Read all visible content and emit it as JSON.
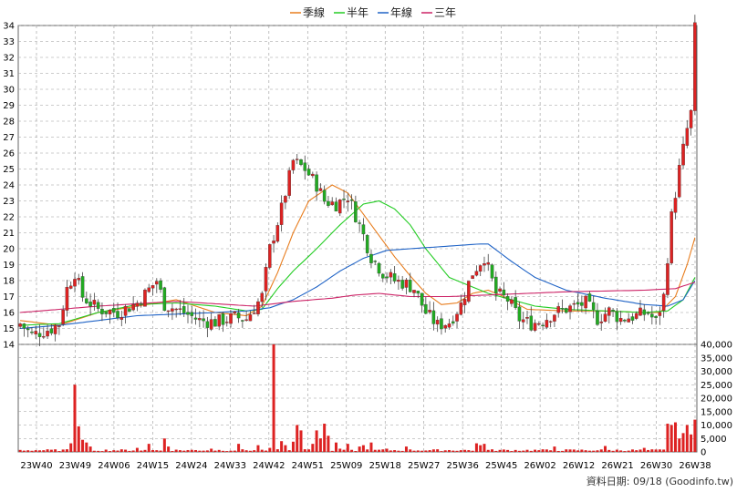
{
  "chart_data": {
    "type": "candlestick",
    "legend": {
      "placement": "top-center",
      "items": [
        {
          "name": "季線",
          "color": "#e87d1e"
        },
        {
          "name": "半年",
          "color": "#22cc22"
        },
        {
          "name": "年線",
          "color": "#1f63c6"
        },
        {
          "name": "三年",
          "color": "#cc2266"
        }
      ]
    },
    "price_axis": {
      "min": 14,
      "max": 34,
      "ticks": [
        14,
        15,
        16,
        17,
        18,
        19,
        20,
        21,
        22,
        23,
        24,
        25,
        26,
        27,
        28,
        29,
        30,
        31,
        32,
        33,
        34
      ],
      "side": "left"
    },
    "volume_axis": {
      "min": 0,
      "max": 40000,
      "ticks": [
        0,
        5000,
        10000,
        15000,
        20000,
        25000,
        30000,
        35000,
        40000
      ],
      "tick_labels": [
        "0",
        "5,000",
        "10,000",
        "15,000",
        "20,000",
        "25,000",
        "30,000",
        "35,000",
        "40,000"
      ],
      "side": "right"
    },
    "x_labels": [
      "23W40",
      "23W49",
      "24W06",
      "24W15",
      "24W24",
      "24W33",
      "24W42",
      "24W51",
      "25W09",
      "25W18",
      "25W27",
      "25W36",
      "25W45",
      "26W02",
      "26W12",
      "26W21",
      "26W30",
      "26W38"
    ],
    "colors": {
      "up": "#dd2222",
      "down": "#22aa22",
      "wick": "#444444",
      "volume": "#dd2222",
      "grid": "#999999"
    },
    "grid": true,
    "footer": "資料日期: 09/18  (Goodinfo.tw)",
    "anchors": {
      "close": [
        [
          0,
          15.3
        ],
        [
          3,
          14.6
        ],
        [
          8,
          15
        ],
        [
          10,
          15.3
        ],
        [
          12,
          17.5
        ],
        [
          14,
          18.5
        ],
        [
          16,
          17
        ],
        [
          20,
          16.2
        ],
        [
          25,
          16
        ],
        [
          30,
          16.6
        ],
        [
          35,
          18
        ],
        [
          37,
          16.5
        ],
        [
          42,
          16
        ],
        [
          46,
          15.5
        ],
        [
          50,
          15.4
        ],
        [
          55,
          15.7
        ],
        [
          58,
          15.6
        ],
        [
          62,
          17
        ],
        [
          64,
          20
        ],
        [
          67,
          22.5
        ],
        [
          70,
          25.5
        ],
        [
          73,
          25
        ],
        [
          76,
          24
        ],
        [
          78,
          23
        ],
        [
          81,
          22.8
        ],
        [
          84,
          23.3
        ],
        [
          87,
          21.5
        ],
        [
          90,
          19.5
        ],
        [
          93,
          18.5
        ],
        [
          96,
          18
        ],
        [
          99,
          17.8
        ],
        [
          101,
          17.5
        ],
        [
          104,
          16
        ],
        [
          107,
          15.2
        ],
        [
          110,
          15.4
        ],
        [
          113,
          16.5
        ],
        [
          116,
          18.5
        ],
        [
          119,
          19.5
        ],
        [
          122,
          17.2
        ],
        [
          125,
          16.8
        ],
        [
          128,
          15.6
        ],
        [
          131,
          15.3
        ],
        [
          134,
          15.5
        ],
        [
          137,
          16
        ],
        [
          141,
          16.3
        ],
        [
          145,
          16.6
        ],
        [
          148,
          15.6
        ],
        [
          151,
          16.1
        ],
        [
          154,
          15.6
        ],
        [
          158,
          15.8
        ],
        [
          161,
          16
        ],
        [
          163,
          15.4
        ],
        [
          165,
          17
        ],
        [
          167,
          22
        ],
        [
          169,
          25
        ],
        [
          171,
          27.5
        ],
        [
          172,
          28.5
        ],
        [
          173,
          33.8
        ]
      ],
      "ma_q": [
        [
          0,
          15.5
        ],
        [
          10,
          15.2
        ],
        [
          20,
          16
        ],
        [
          30,
          16.4
        ],
        [
          40,
          16.8
        ],
        [
          50,
          16
        ],
        [
          58,
          15.8
        ],
        [
          62,
          16.4
        ],
        [
          66,
          18.5
        ],
        [
          70,
          21
        ],
        [
          74,
          23
        ],
        [
          80,
          24
        ],
        [
          84,
          23.5
        ],
        [
          90,
          21.5
        ],
        [
          96,
          19.5
        ],
        [
          100,
          18.3
        ],
        [
          104,
          17.2
        ],
        [
          108,
          16.5
        ],
        [
          112,
          16.6
        ],
        [
          116,
          17.2
        ],
        [
          120,
          17.4
        ],
        [
          124,
          17
        ],
        [
          130,
          16.2
        ],
        [
          140,
          16.1
        ],
        [
          150,
          16.1
        ],
        [
          160,
          16
        ],
        [
          164,
          16
        ],
        [
          168,
          17
        ],
        [
          171,
          19
        ],
        [
          173,
          20.7
        ]
      ],
      "ma_h": [
        [
          0,
          15.2
        ],
        [
          10,
          15.3
        ],
        [
          20,
          16
        ],
        [
          30,
          16.5
        ],
        [
          40,
          16.6
        ],
        [
          50,
          16.4
        ],
        [
          58,
          16.1
        ],
        [
          62,
          16.2
        ],
        [
          66,
          17.5
        ],
        [
          70,
          18.6
        ],
        [
          76,
          20
        ],
        [
          82,
          21.5
        ],
        [
          88,
          22.8
        ],
        [
          92,
          23
        ],
        [
          96,
          22.5
        ],
        [
          100,
          21.5
        ],
        [
          104,
          20
        ],
        [
          110,
          18.2
        ],
        [
          116,
          17.6
        ],
        [
          120,
          17.2
        ],
        [
          126,
          16.8
        ],
        [
          132,
          16.4
        ],
        [
          140,
          16.2
        ],
        [
          150,
          16.1
        ],
        [
          160,
          16
        ],
        [
          166,
          16.1
        ],
        [
          170,
          16.8
        ],
        [
          173,
          18.2
        ]
      ],
      "ma_y": [
        [
          0,
          15
        ],
        [
          10,
          15.2
        ],
        [
          20,
          15.5
        ],
        [
          30,
          15.8
        ],
        [
          40,
          15.9
        ],
        [
          50,
          16
        ],
        [
          58,
          16.1
        ],
        [
          64,
          16.3
        ],
        [
          70,
          16.8
        ],
        [
          76,
          17.6
        ],
        [
          82,
          18.6
        ],
        [
          88,
          19.4
        ],
        [
          94,
          19.9
        ],
        [
          100,
          20
        ],
        [
          106,
          20.1
        ],
        [
          112,
          20.2
        ],
        [
          118,
          20.3
        ],
        [
          120,
          20.3
        ],
        [
          126,
          19.2
        ],
        [
          132,
          18.2
        ],
        [
          140,
          17.4
        ],
        [
          150,
          16.9
        ],
        [
          160,
          16.5
        ],
        [
          166,
          16.4
        ],
        [
          170,
          16.8
        ],
        [
          173,
          18
        ]
      ],
      "ma_3y": [
        [
          0,
          16
        ],
        [
          20,
          16.4
        ],
        [
          40,
          16.7
        ],
        [
          60,
          16.4
        ],
        [
          70,
          16.7
        ],
        [
          80,
          16.9
        ],
        [
          86,
          17.1
        ],
        [
          92,
          17.2
        ],
        [
          100,
          17
        ],
        [
          110,
          17
        ],
        [
          120,
          17.1
        ],
        [
          130,
          17.2
        ],
        [
          140,
          17.3
        ],
        [
          160,
          17.4
        ],
        [
          168,
          17.5
        ],
        [
          173,
          17.9
        ]
      ],
      "volume_spikes": [
        [
          13,
          3200
        ],
        [
          14,
          25000
        ],
        [
          15,
          9500
        ],
        [
          16,
          4500
        ],
        [
          17,
          3500
        ],
        [
          18,
          2000
        ],
        [
          30,
          1500
        ],
        [
          33,
          3000
        ],
        [
          37,
          5000
        ],
        [
          38,
          2000
        ],
        [
          49,
          1200
        ],
        [
          56,
          3000
        ],
        [
          61,
          2500
        ],
        [
          64,
          1500
        ],
        [
          65,
          40000
        ],
        [
          67,
          4000
        ],
        [
          68,
          2500
        ],
        [
          70,
          3800
        ],
        [
          71,
          10000
        ],
        [
          72,
          8000
        ],
        [
          75,
          3000
        ],
        [
          76,
          8000
        ],
        [
          77,
          5000
        ],
        [
          78,
          10500
        ],
        [
          79,
          6000
        ],
        [
          81,
          3500
        ],
        [
          82,
          1200
        ],
        [
          84,
          3000
        ],
        [
          87,
          2000
        ],
        [
          88,
          2500
        ],
        [
          90,
          3500
        ],
        [
          94,
          1200
        ],
        [
          99,
          2000
        ],
        [
          117,
          3200
        ],
        [
          118,
          2500
        ],
        [
          119,
          3000
        ],
        [
          137,
          2000
        ],
        [
          150,
          2200
        ],
        [
          160,
          1500
        ],
        [
          166,
          10500
        ],
        [
          167,
          10000
        ],
        [
          168,
          11000
        ],
        [
          169,
          5000
        ],
        [
          170,
          7000
        ],
        [
          171,
          10000
        ],
        [
          172,
          6500
        ],
        [
          173,
          12000
        ]
      ]
    }
  }
}
